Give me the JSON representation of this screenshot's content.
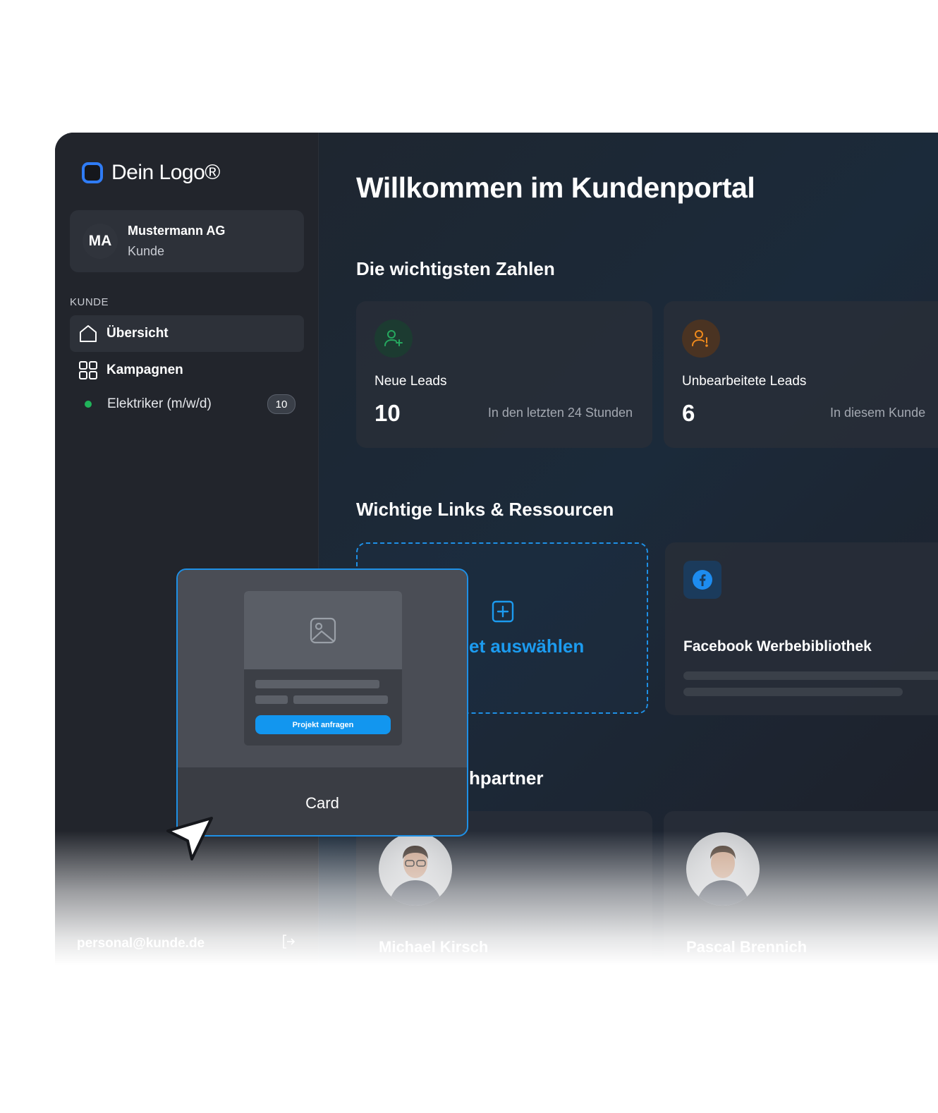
{
  "logo": {
    "text": "Dein Logo®"
  },
  "account": {
    "initials": "MA",
    "name": "Mustermann AG",
    "role": "Kunde"
  },
  "nav": {
    "section": "KUNDE",
    "items": [
      {
        "label": "Übersicht",
        "icon": "home-icon",
        "active": true
      },
      {
        "label": "Kampagnen",
        "icon": "grid-icon",
        "active": false
      }
    ],
    "campaign": {
      "label": "Elektriker (m/w/d)",
      "count": "10",
      "status_color": "#20b35a"
    }
  },
  "footer": {
    "email": "personal@kunde.de",
    "logout_icon": "logout-icon"
  },
  "main": {
    "title": "Willkommen im Kundenportal",
    "stats_heading": "Die wichtigsten Zahlen",
    "stats": [
      {
        "title": "Neue Leads",
        "value": "10",
        "subtitle": "In den letzten 24 Stunden",
        "icon": "user-plus-icon",
        "color": "#26a85f"
      },
      {
        "title": "Unbearbeitete Leads",
        "value": "6",
        "subtitle": "In diesem Kunde",
        "icon": "user-alert-icon",
        "color": "#f08a1c"
      }
    ],
    "links_heading": "Wichtige Links & Ressourcen",
    "dashed_label": "et auswählen",
    "facebook": {
      "title": "Facebook Werbebibliothek",
      "icon": "facebook-icon"
    },
    "contact_heading_partial": "hpartner",
    "contacts": [
      {
        "name": "Michael Kirsch"
      },
      {
        "name": "Pascal Brennich"
      }
    ]
  },
  "floating_card": {
    "button_label": "Projekt anfragen",
    "label": "Card",
    "image_icon": "image-icon"
  },
  "colors": {
    "accent": "#1e90e6",
    "brand": "#2f7cf6"
  }
}
